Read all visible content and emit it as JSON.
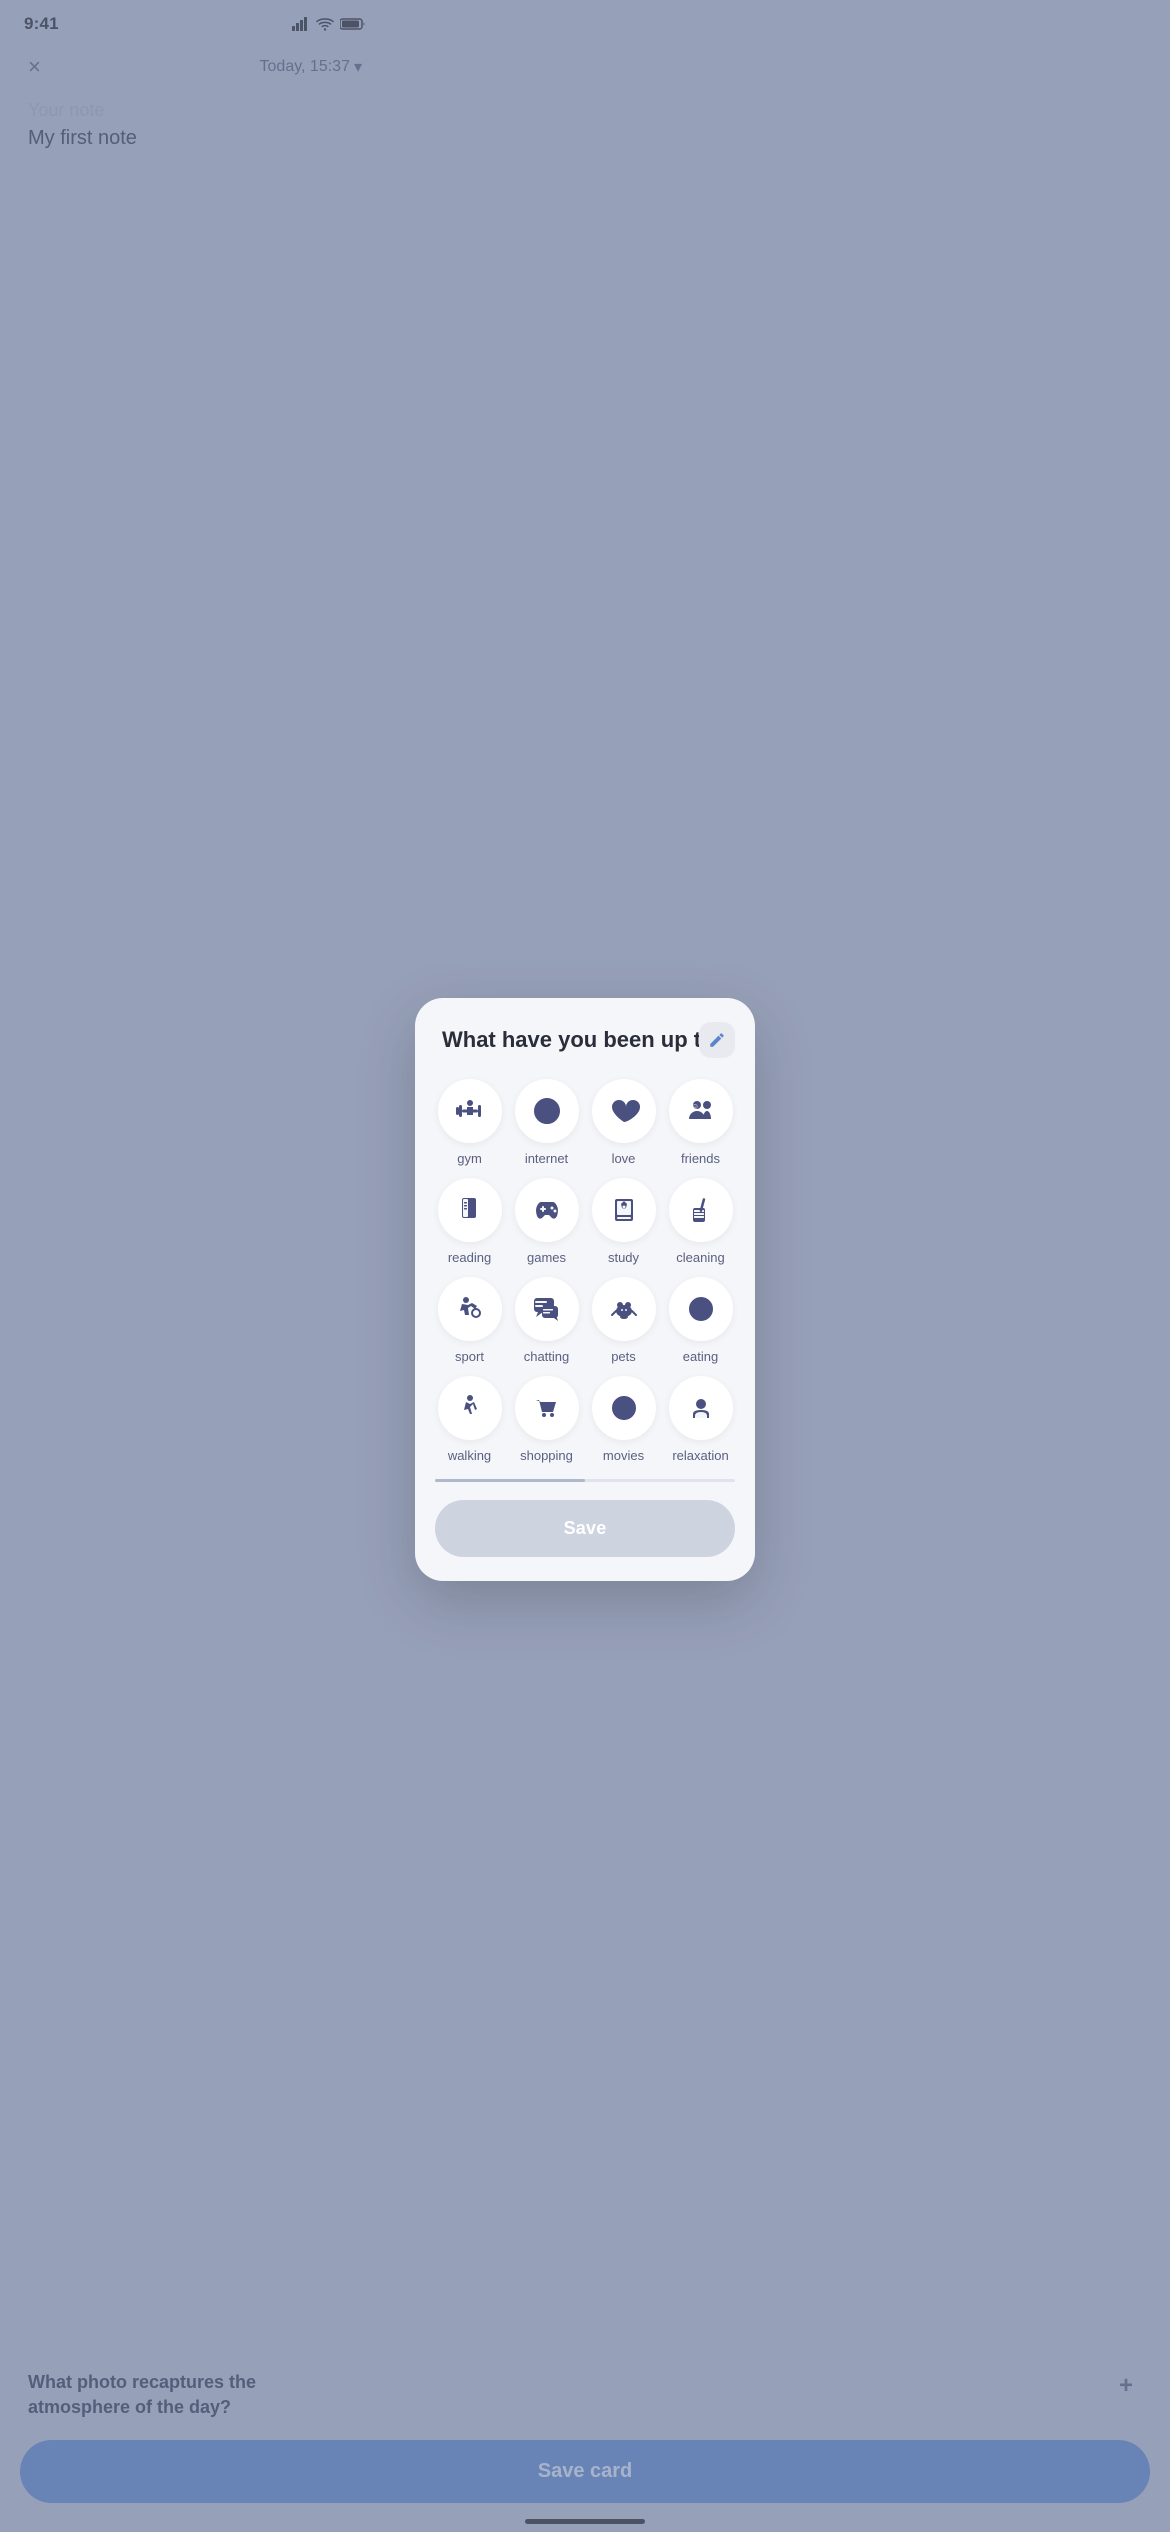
{
  "status": {
    "time": "9:41",
    "signal_icon": "signal",
    "wifi_icon": "wifi",
    "battery_icon": "battery"
  },
  "background": {
    "close_label": "×",
    "date_label": "Today, 15:37",
    "chevron": "▾",
    "note_placeholder": "Your note",
    "note_value": "My first note"
  },
  "modal": {
    "title": "What have you been up to?",
    "edit_icon": "pencil",
    "activities": [
      {
        "id": "gym",
        "label": "gym",
        "icon": "gym"
      },
      {
        "id": "internet",
        "label": "internet",
        "icon": "internet"
      },
      {
        "id": "love",
        "label": "love",
        "icon": "love"
      },
      {
        "id": "friends",
        "label": "friends",
        "icon": "friends"
      },
      {
        "id": "reading",
        "label": "reading",
        "icon": "reading"
      },
      {
        "id": "games",
        "label": "games",
        "icon": "games"
      },
      {
        "id": "study",
        "label": "study",
        "icon": "study"
      },
      {
        "id": "cleaning",
        "label": "cleaning",
        "icon": "cleaning"
      },
      {
        "id": "sport",
        "label": "sport",
        "icon": "sport"
      },
      {
        "id": "chatting",
        "label": "chatting",
        "icon": "chatting"
      },
      {
        "id": "pets",
        "label": "pets",
        "icon": "pets"
      },
      {
        "id": "eating",
        "label": "eating",
        "icon": "eating"
      },
      {
        "id": "walking",
        "label": "walking",
        "icon": "walking"
      },
      {
        "id": "shopping",
        "label": "shopping",
        "icon": "shopping"
      },
      {
        "id": "movies",
        "label": "movies",
        "icon": "movies"
      },
      {
        "id": "relaxation",
        "label": "relaxation",
        "icon": "relaxation"
      }
    ],
    "save_label": "Save"
  },
  "bottom": {
    "photo_question": "What photo recaptures the atmosphere of the day?",
    "plus_label": "+",
    "save_card_label": "Save card"
  }
}
